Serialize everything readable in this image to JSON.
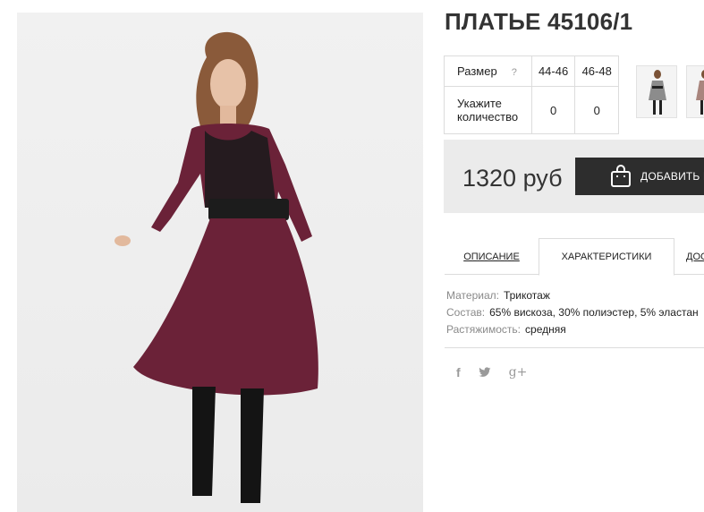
{
  "product": {
    "title": "ПЛАТЬЕ 45106/1",
    "main_image_icon": "model-photo-icon"
  },
  "size_table": {
    "size_label": "Размер",
    "help_mark": "?",
    "sizes": [
      "44-46",
      "46-48"
    ],
    "quantity_label": "Укажите количество",
    "quantities": [
      "0",
      "0"
    ]
  },
  "thumbnails": [
    "thumbnail-grey-dress",
    "thumbnail-pink-dress"
  ],
  "purchase": {
    "price": "1320 руб",
    "cart_label": "ДОБАВИТЬ В КОРЗИНУ",
    "cart_icon": "shopping-bag-icon",
    "button_color": "#2d2d2d"
  },
  "tabs": [
    "ОПИСАНИЕ",
    "ХАРАКТЕРИСТИКИ",
    "ДОСТАВКА"
  ],
  "characteristics": [
    {
      "key": "Материал:",
      "value": "Трикотаж"
    },
    {
      "key": "Состав:",
      "value": "65% вискоза, 30% полиэстер, 5% эластан"
    },
    {
      "key": "Растяжимость:",
      "value": "средняя"
    }
  ],
  "social": {
    "facebook": "f",
    "twitter": "twitter-bird-icon",
    "google": "g+"
  },
  "colors": {
    "dress": "#6b2238",
    "panel_bg": "#ebebeb",
    "text": "#333333",
    "muted": "#8a8a8a"
  }
}
